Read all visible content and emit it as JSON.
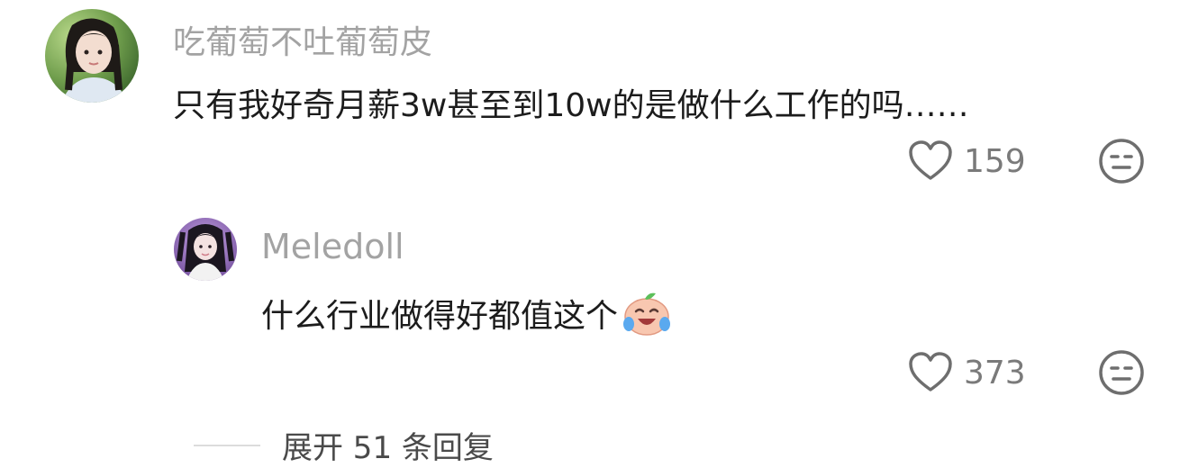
{
  "comments": [
    {
      "username": "吃葡萄不吐葡萄皮",
      "text": "只有我好奇月薪3w甚至到10w的是做什么工作的吗……",
      "likes": "159",
      "avatar_icon": "avatar-girl-nature-photo",
      "like_icon": "heart-outline-icon",
      "dislike_icon": "neutral-face-icon"
    },
    {
      "username": "Meledoll",
      "text": "什么行业做得好都值这个",
      "emoji": "crying-laughing-peach-emoji",
      "likes": "373",
      "avatar_icon": "avatar-girl-purple-photo",
      "like_icon": "heart-outline-icon",
      "dislike_icon": "neutral-face-icon"
    }
  ],
  "expand_replies": {
    "label": "展开 51 条回复"
  },
  "colors": {
    "username": "#a3a3a3",
    "text": "#1c1c1c",
    "meta": "#7a7a7a",
    "divider": "#dcdcdc"
  }
}
